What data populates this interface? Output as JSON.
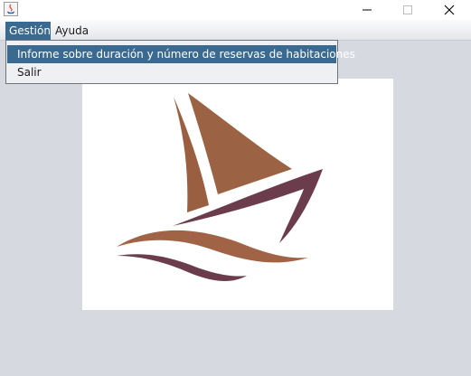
{
  "window": {
    "controls": {
      "minimize_icon": "minimize-icon",
      "maximize_icon": "maximize-icon",
      "close_icon": "close-icon"
    }
  },
  "menubar": {
    "items": [
      {
        "label": "Gestión",
        "selected": true
      },
      {
        "label": "Ayuda",
        "selected": false
      }
    ]
  },
  "dropdown": {
    "items": [
      {
        "label": "Informe sobre duración y número de reservas de habitaciones",
        "highlighted": true
      },
      {
        "label": "Salir",
        "highlighted": false
      }
    ]
  },
  "colors": {
    "accent": "#3a6a8f",
    "background": "#d6d9df",
    "sail": "#9b6244",
    "hull": "#6a3c4c"
  }
}
